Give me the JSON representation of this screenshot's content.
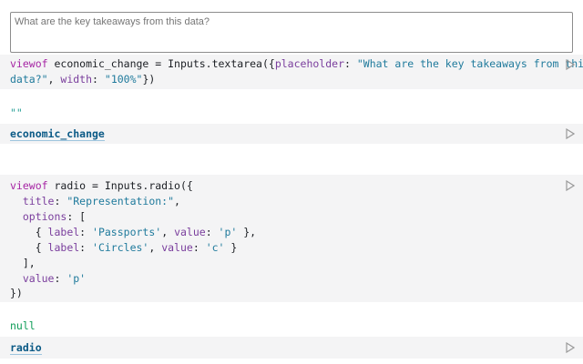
{
  "textarea": {
    "placeholder": "What are the key takeaways from this data?"
  },
  "cell1": {
    "code_line1": {
      "viewof": "viewof",
      "name": "economic_change",
      "eq": " = ",
      "call": "Inputs.textarea({",
      "key": "placeholder",
      "colon": ": ",
      "value": "\"What are the key takeaways from this",
      "part2_value": "data?\"",
      "part2_mid": ", ",
      "part2_key": "width",
      "part2_colon": ": ",
      "part2_width": "\"100%\"",
      "part2_end": "})"
    },
    "output": "\"\"",
    "cell_name": "economic_change"
  },
  "cell2": {
    "lines": {
      "l1_viewof": "viewof",
      "l1_rest": " radio = Inputs.radio({",
      "l2_key": "  title",
      "l2_colon": ": ",
      "l2_val": "\"Representation:\"",
      "l2_end": ",",
      "l3_key": "  options",
      "l3_rest": ": [",
      "l4_open": "    { ",
      "l4_label_key": "label",
      "l4_c1": ": ",
      "l4_label": "'Passports'",
      "l4_c2": ", ",
      "l4_value_key": "value",
      "l4_c3": ": ",
      "l4_value": "'p'",
      "l4_close": " },",
      "l5_open": "    { ",
      "l5_label_key": "label",
      "l5_c1": ": ",
      "l5_label": "'Circles'",
      "l5_c2": ", ",
      "l5_value_key": "value",
      "l5_c3": ": ",
      "l5_value": "'c'",
      "l5_close": " }",
      "l6": "  ],",
      "l7_key": "  value",
      "l7_colon": ": ",
      "l7_val": "'p'",
      "l8": "})"
    },
    "output": "null",
    "cell_name": "radio"
  },
  "icons": {
    "run": "play-triangle-icon"
  }
}
